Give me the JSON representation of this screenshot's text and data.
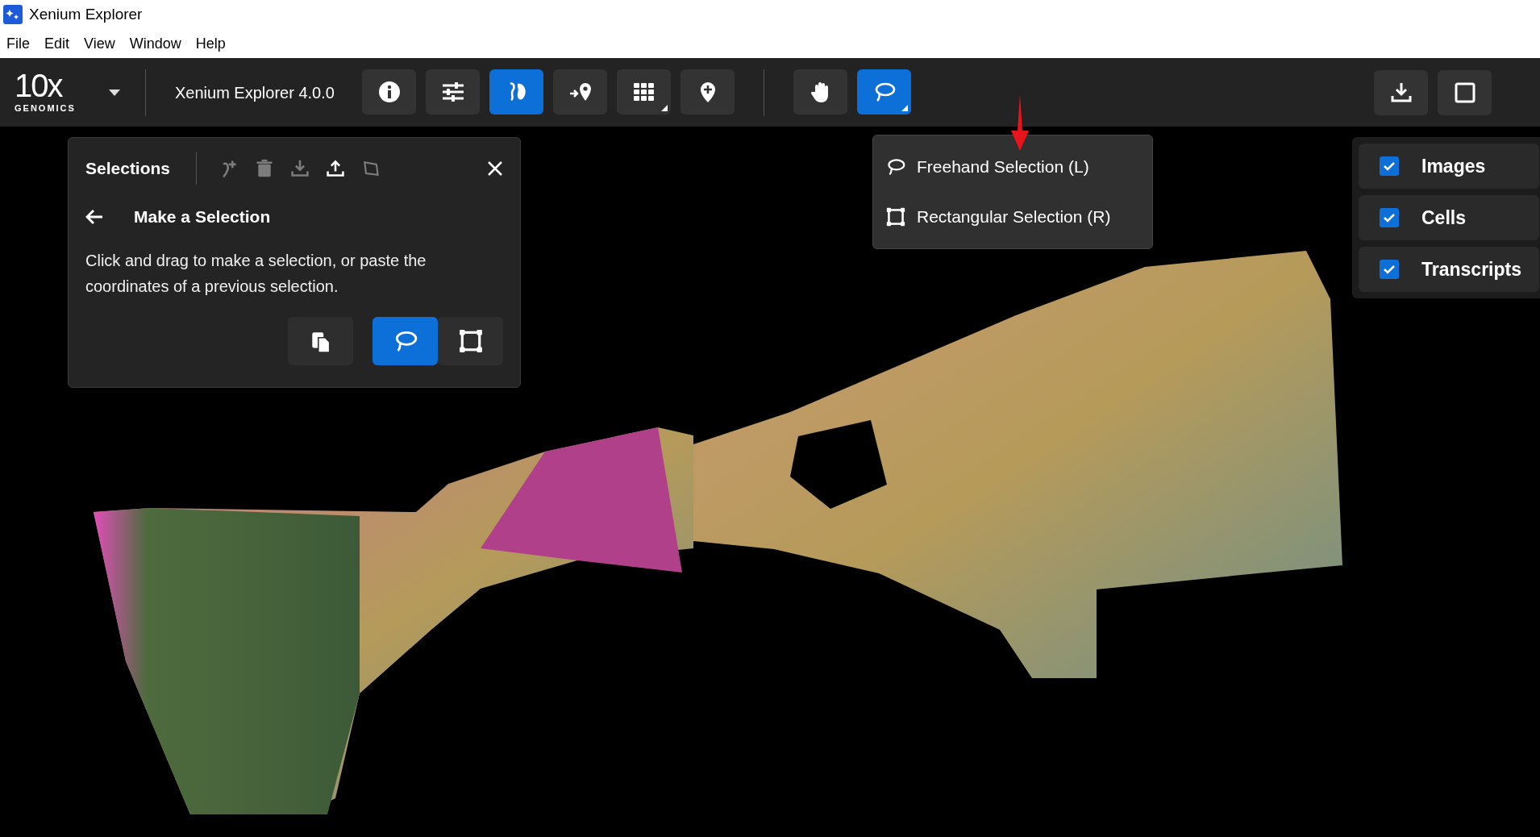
{
  "window": {
    "title": "Xenium Explorer"
  },
  "menu": [
    "File",
    "Edit",
    "View",
    "Window",
    "Help"
  ],
  "toolbar": {
    "logo": {
      "text": "10x",
      "subtitle": "GENOMICS"
    },
    "app_title": "Xenium Explorer 4.0.0",
    "tools": [
      {
        "kind": "info",
        "selected": false,
        "submenu": false
      },
      {
        "kind": "sliders",
        "selected": false,
        "submenu": false
      },
      {
        "kind": "cells",
        "selected": true,
        "submenu": false
      },
      {
        "kind": "goto",
        "selected": false,
        "submenu": false
      },
      {
        "kind": "grid",
        "selected": false,
        "submenu": true
      },
      {
        "kind": "pin",
        "selected": false,
        "submenu": false
      },
      {
        "kind": "hand",
        "selected": false,
        "submenu": false
      },
      {
        "kind": "lasso",
        "selected": true,
        "submenu": true
      }
    ],
    "right_tools": [
      {
        "kind": "download",
        "selected": false,
        "submenu": false
      },
      {
        "kind": "panel",
        "selected": false,
        "submenu": false
      }
    ]
  },
  "selections_panel": {
    "title": "Selections",
    "actions": [
      {
        "kind": "add",
        "disabled": true
      },
      {
        "kind": "trash",
        "disabled": true
      },
      {
        "kind": "download",
        "disabled": true
      },
      {
        "kind": "upload",
        "disabled": false
      },
      {
        "kind": "polygon",
        "disabled": true
      }
    ],
    "heading": "Make a Selection",
    "description": "Click and drag to make a selection, or paste the coordinates of a previous selection.",
    "modes": [
      {
        "kind": "paste",
        "selected": false
      },
      {
        "kind": "lasso",
        "selected": true
      },
      {
        "kind": "rect",
        "selected": false
      }
    ]
  },
  "selection_menu": [
    {
      "kind": "lasso",
      "label": "Freehand Selection (L)"
    },
    {
      "kind": "rect",
      "label": "Rectangular Selection (R)"
    }
  ],
  "layers": [
    {
      "label": "Images",
      "checked": true
    },
    {
      "label": "Cells",
      "checked": true
    },
    {
      "label": "Transcripts",
      "checked": true
    }
  ]
}
